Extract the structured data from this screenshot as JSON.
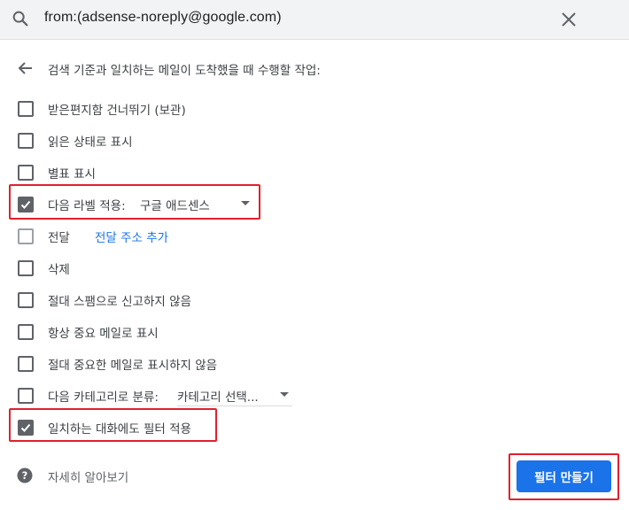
{
  "search": {
    "query": "from:(adsense-noreply@google.com)"
  },
  "header": {
    "text": "검색 기준과 일치하는 메일이 도착했을 때 수행할 작업:"
  },
  "options": [
    {
      "label": "받은편지함 건너뛰기 (보관)",
      "checked": false
    },
    {
      "label": "읽은 상태로 표시",
      "checked": false
    },
    {
      "label": "별표 표시",
      "checked": false
    },
    {
      "label": "다음 라벨 적용:",
      "checked": true,
      "dropdown_value": "구글 애드센스"
    },
    {
      "label": "전달",
      "checked": false,
      "link": "전달 주소 추가"
    },
    {
      "label": "삭제",
      "checked": false
    },
    {
      "label": "절대 스팸으로 신고하지 않음",
      "checked": false
    },
    {
      "label": "항상 중요 메일로 표시",
      "checked": false
    },
    {
      "label": "절대 중요한 메일로 표시하지 않음",
      "checked": false
    },
    {
      "label": "다음 카테고리로 분류:",
      "checked": false,
      "dropdown_value": "카테고리 선택..."
    },
    {
      "label": "일치하는 대화에도 필터 적용",
      "checked": true
    }
  ],
  "footer": {
    "help_text": "자세히 알아보기",
    "create_button": "필터 만들기"
  },
  "colors": {
    "accent": "#1a73e8",
    "highlight": "#e0202e",
    "search_bg": "#f1f3f4"
  }
}
